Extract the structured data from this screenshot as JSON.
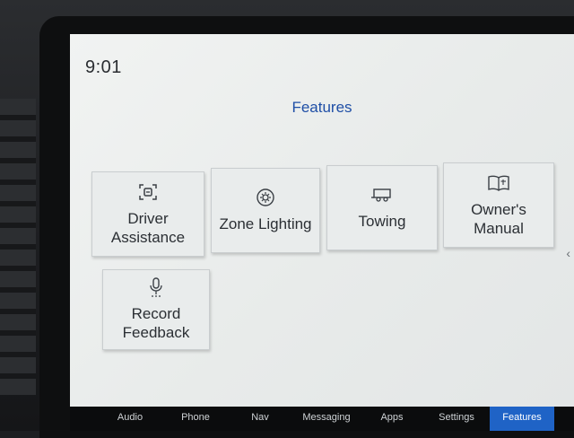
{
  "status": {
    "time": "9:01"
  },
  "page": {
    "title": "Features"
  },
  "tiles": [
    {
      "label": "Driver\nAssistance",
      "icon": "driver-assist-icon"
    },
    {
      "label": "Zone Lighting",
      "icon": "zone-lighting-icon"
    },
    {
      "label": "Towing",
      "icon": "trailer-icon"
    },
    {
      "label": "Owner's\nManual",
      "icon": "book-icon"
    },
    {
      "label": "Record\nFeedback",
      "icon": "microphone-icon"
    }
  ],
  "nav": {
    "items": [
      "Audio",
      "Phone",
      "Nav",
      "Messaging",
      "Apps",
      "Settings",
      "Features"
    ],
    "active": "Features",
    "active_color": "#1f63c6"
  },
  "colors": {
    "title": "#1f4fa6",
    "screen_bg": "#eceeed"
  }
}
